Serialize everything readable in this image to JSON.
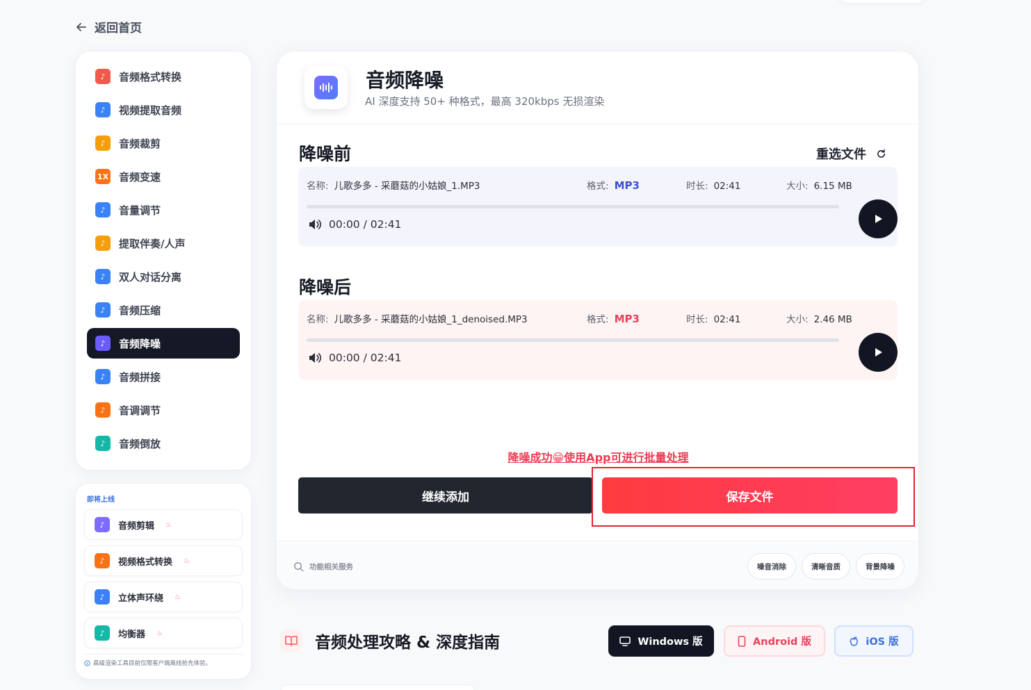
{
  "nav": {
    "back_label": "返回首页"
  },
  "sidebar": {
    "items": [
      {
        "label": "音频格式转换",
        "icon": "format-convert-icon",
        "color": "#ef5a4a"
      },
      {
        "label": "视频提取音频",
        "icon": "video-extract-icon",
        "color": "#3b82f6"
      },
      {
        "label": "音频裁剪",
        "icon": "scissors-music-icon",
        "color": "#f59e0b"
      },
      {
        "label": "音频变速",
        "icon": "speed-icon",
        "color": "#f97316",
        "text": "1X"
      },
      {
        "label": "音量调节",
        "icon": "volume-icon",
        "color": "#3b82f6"
      },
      {
        "label": "提取伴奏/人声",
        "icon": "vocal-extract-icon",
        "color": "#f59e0b"
      },
      {
        "label": "双人对话分离",
        "icon": "dialog-split-icon",
        "color": "#3b82f6"
      },
      {
        "label": "音频压缩",
        "icon": "compress-icon",
        "color": "#3b82f6"
      },
      {
        "label": "音频降噪",
        "icon": "denoise-icon",
        "color": "#6b5cff",
        "active": true
      },
      {
        "label": "音频拼接",
        "icon": "merge-icon",
        "color": "#3b82f6"
      },
      {
        "label": "音调调节",
        "icon": "pitch-icon",
        "color": "#f97316"
      },
      {
        "label": "音频倒放",
        "icon": "reverse-icon",
        "color": "#14b8a6"
      }
    ]
  },
  "coming_soon": {
    "title": "即将上线",
    "items": [
      {
        "label": "音频剪辑",
        "icon": "audio-edit-icon",
        "color": "#7c6cff"
      },
      {
        "label": "视频格式转换",
        "icon": "video-convert-icon",
        "color": "#f97316"
      },
      {
        "label": "立体声环绕",
        "icon": "surround-icon",
        "color": "#3b82f6"
      },
      {
        "label": "均衡器",
        "icon": "equalizer-icon",
        "color": "#14b8a6"
      }
    ],
    "note": "高级渲染工具目前仅限客户端离线抢先体验。"
  },
  "header": {
    "title": "音频降噪",
    "subtitle": "AI 深度支持 50+ 种格式，最高 320kbps 无损渲染"
  },
  "before": {
    "section_title": "降噪前",
    "reselect_label": "重选文件",
    "name_label": "名称:",
    "name": "儿歌多多 - 采蘑菇的小姑娘_1.MP3",
    "format_label": "格式:",
    "format": "MP3",
    "duration_label": "时长:",
    "duration": "02:41",
    "size_label": "大小:",
    "size": "6.15 MB",
    "time": "00:00 / 02:41"
  },
  "after": {
    "section_title": "降噪后",
    "name_label": "名称:",
    "name": "儿歌多多 - 采蘑菇的小姑娘_1_denoised.MP3",
    "format_label": "格式:",
    "format": "MP3",
    "duration_label": "时长:",
    "duration": "02:41",
    "size_label": "大小:",
    "size": "2.46 MB",
    "time": "00:00 / 02:41"
  },
  "result": {
    "success_text": "降噪成功😁使用App可进行批量处理",
    "continue_label": "继续添加",
    "save_label": "保存文件"
  },
  "footer": {
    "related_label": "功能相关服务",
    "tags": [
      "噪音消除",
      "清晰音质",
      "背景降噪"
    ]
  },
  "guide": {
    "title": "音频处理攻略 & 深度指南",
    "windows_label": "Windows 版",
    "android_label": "Android 版",
    "ios_label": "iOS 版"
  },
  "colors": {
    "accent_red": "#ff3d50",
    "dark": "#141925",
    "highlight_border": "#e0252f"
  }
}
